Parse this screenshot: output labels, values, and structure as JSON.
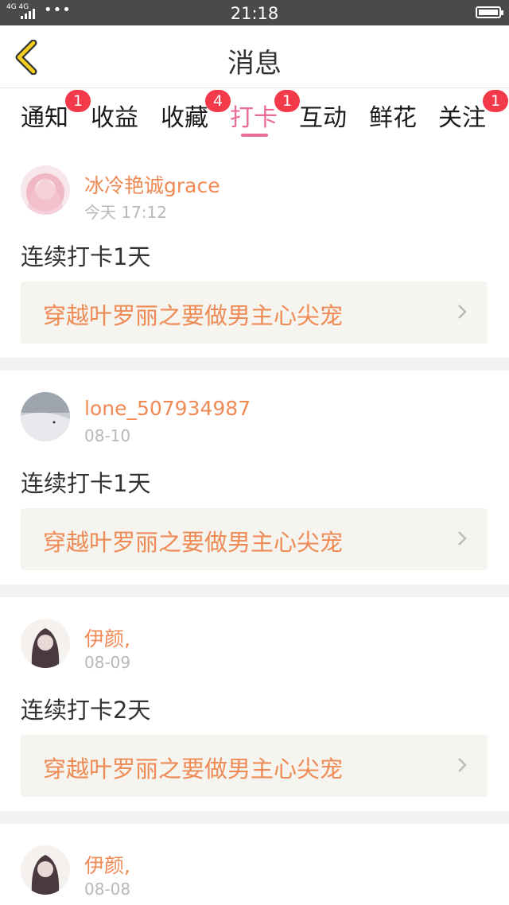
{
  "status_bar": {
    "network": "4G 4G",
    "signal_arrows": "⇅",
    "dots": "•••",
    "time": "21:18"
  },
  "header": {
    "back_icon": "chevron-left-icon",
    "title": "消息"
  },
  "tabs": [
    {
      "label": "通知",
      "badge": "1"
    },
    {
      "label": "收益",
      "badge": ""
    },
    {
      "label": "收藏",
      "badge": "4"
    },
    {
      "label": "打卡",
      "badge": "1",
      "active": true
    },
    {
      "label": "互动",
      "badge": ""
    },
    {
      "label": "鲜花",
      "badge": ""
    },
    {
      "label": "关注",
      "badge": "1"
    }
  ],
  "colors": {
    "accent": "#e96b9a",
    "name": "#ef8a55",
    "badge": "#f23a4a",
    "card_bg": "#f5f4ef"
  },
  "messages": [
    {
      "username": "冰冷艳诚grace",
      "date": "今天 17:12",
      "content": "连续打卡1天",
      "book": "穿越叶罗丽之要做男主心尖宠"
    },
    {
      "username": "lone_507934987",
      "date": "08-10",
      "content": "连续打卡1天",
      "book": "穿越叶罗丽之要做男主心尖宠"
    },
    {
      "username": "伊颜,",
      "date": "08-09",
      "content": "连续打卡2天",
      "book": "穿越叶罗丽之要做男主心尖宠"
    },
    {
      "username": "伊颜,",
      "date": "08-08"
    }
  ]
}
